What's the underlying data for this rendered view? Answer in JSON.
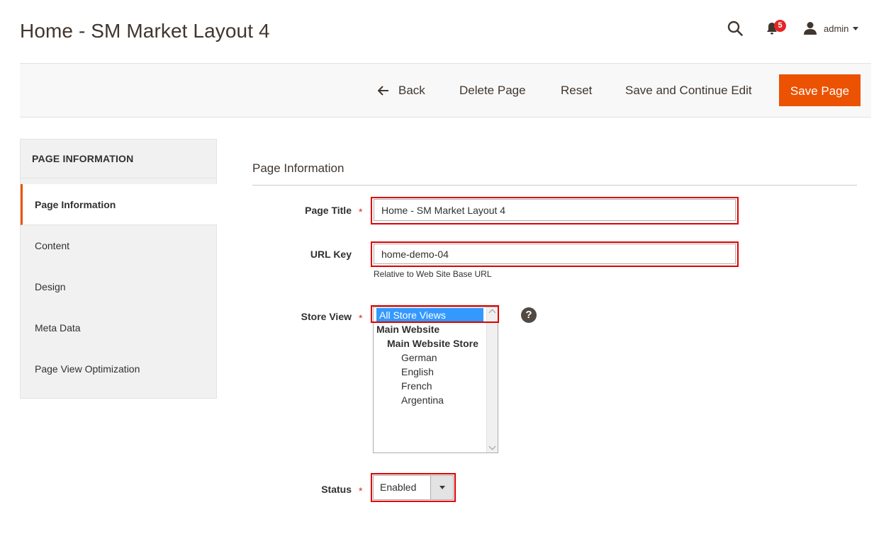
{
  "header": {
    "title": "Home - SM Market Layout 4",
    "notification_count": "5",
    "user_name": "admin"
  },
  "toolbar": {
    "back_label": "Back",
    "delete_label": "Delete Page",
    "reset_label": "Reset",
    "save_continue_label": "Save and Continue Edit",
    "save_label": "Save Page"
  },
  "sidebar": {
    "title": "PAGE INFORMATION",
    "items": [
      {
        "label": "Page Information",
        "active": true
      },
      {
        "label": "Content",
        "active": false
      },
      {
        "label": "Design",
        "active": false
      },
      {
        "label": "Meta Data",
        "active": false
      },
      {
        "label": "Page View Optimization",
        "active": false
      }
    ]
  },
  "form": {
    "section_title": "Page Information",
    "page_title": {
      "label": "Page Title",
      "value": "Home - SM Market Layout 4",
      "required": "*"
    },
    "url_key": {
      "label": "URL Key",
      "value": "home-demo-04",
      "note": "Relative to Web Site Base URL"
    },
    "store_view": {
      "label": "Store View",
      "required": "*",
      "options": [
        {
          "label": "All Store Views",
          "selected": true,
          "level": 0
        },
        {
          "label": "Main Website",
          "group": true,
          "level": 0
        },
        {
          "label": "Main Website Store",
          "group": true,
          "level": 1
        },
        {
          "label": "German",
          "level": 2
        },
        {
          "label": "English",
          "level": 2
        },
        {
          "label": "French",
          "level": 2
        },
        {
          "label": "Argentina",
          "level": 2
        }
      ],
      "help": "?"
    },
    "status": {
      "label": "Status",
      "value": "Enabled",
      "required": "*"
    }
  },
  "colors": {
    "accent": "#eb5202",
    "highlight": "#e00000",
    "selection": "#3399ff"
  }
}
